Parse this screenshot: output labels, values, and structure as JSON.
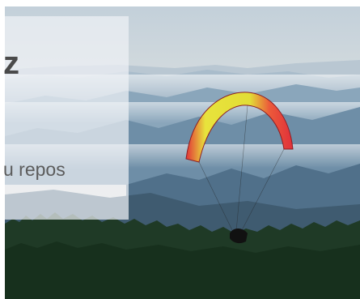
{
  "banner": {
    "image_alt": "paraglider-over-misty-mountains",
    "colors": {
      "sky": "#cfd9e1",
      "haze": "#e4e7e6",
      "mountains": "#6f8fa8",
      "forest": "#1f3a26",
      "wing_red": "#e0303a",
      "wing_yellow": "#e4e33a"
    }
  },
  "card": {
    "title": "z",
    "text": "u repos"
  }
}
